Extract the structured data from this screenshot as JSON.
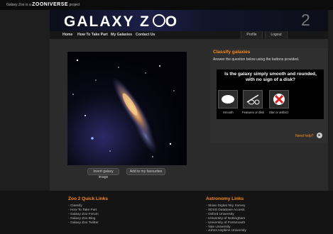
{
  "top_strip": {
    "prefix": "Galaxy Zoo is a",
    "brand": "ZOONIVERSE",
    "suffix": "project"
  },
  "header": {
    "logo": "GALAXY Z",
    "logo_tail": "O",
    "number": "2"
  },
  "nav": {
    "items": [
      "Home",
      "How To Take Part",
      "My Galaxies",
      "Contact Us"
    ],
    "profile": "Profile",
    "logout": "Logout"
  },
  "image_panel": {
    "invert_label": "Invert galaxy image",
    "favourite_label": "Add to my favourites"
  },
  "classify": {
    "title": "Classify galaxies",
    "description": "Answer the question below using the buttons provided.",
    "question": "Is the galaxy simply smooth and rounded, with no sign of a disk?",
    "options": [
      {
        "label": "Smooth",
        "icon": "smooth-blob-icon"
      },
      {
        "label": "Features or disk",
        "icon": "disk-icon"
      },
      {
        "label": "Star or artifact",
        "icon": "cross-icon"
      }
    ],
    "help": "Need help?"
  },
  "footer": {
    "quick_links_title": "Zoo 2 Quick Links",
    "quick_links": [
      "Classify",
      "How To Take Part",
      "Galaxy Zoo Forum",
      "Galaxy Zoo Blog",
      "Galaxy Zoo Twitter"
    ],
    "astro_title": "Astronomy Links",
    "astro_links": [
      "Sloan Digital Sky Survey",
      "SDSS Database Access",
      "Oxford University",
      "University of Nottingham",
      "University of Portsmouth",
      "Yale University",
      "Johns Hopkins University"
    ]
  },
  "colors": {
    "accent": "#ff8a1e",
    "background": "#1e1e1e",
    "panel": "#2b2b2b"
  }
}
